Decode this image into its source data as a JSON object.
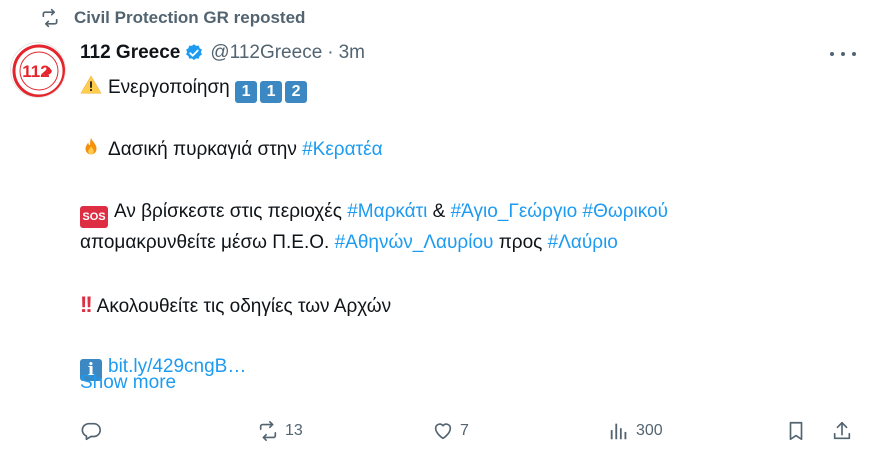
{
  "repost": {
    "text": "Civil Protection GR reposted",
    "icon": "repost-icon"
  },
  "author": {
    "name": "112 Greece",
    "handle": "@112Greece",
    "separator": "·",
    "time": "3m",
    "verified_color": "#1d9bf0",
    "avatar_text": "112"
  },
  "tweet": {
    "line1": {
      "text": "Ενεργοποίηση",
      "keycaps": [
        "1",
        "1",
        "2"
      ]
    },
    "line2": {
      "text": "Δασική πυρκαγιά στην",
      "tag": "#Κερατέα"
    },
    "line3": {
      "sos": "SOS",
      "text": "Αν βρίσκεστε στις περιοχές",
      "tag1": "#Μαρκάτι",
      "amp": "&",
      "tag2": "#Άγιο_Γεώργιο",
      "tag3": "#Θωρικού"
    },
    "line4": {
      "text": "απομακρυνθείτε μέσω Π.Ε.Ο.",
      "tag1": "#Αθηνών_Λαυρίου",
      "mid": "προς",
      "tag2": "#Λαύριο"
    },
    "line5": {
      "text": "Ακολουθείτε τις οδηγίες των Αρχών"
    },
    "line6": {
      "link": "bit.ly/429cngB…"
    },
    "show_more": "Show more"
  },
  "actions": {
    "reply": {
      "icon": "reply-icon"
    },
    "repost": {
      "icon": "repost-icon",
      "count": "13"
    },
    "like": {
      "icon": "heart-icon",
      "count": "7"
    },
    "views": {
      "icon": "views-icon",
      "count": "300"
    },
    "bookmark": {
      "icon": "bookmark-icon"
    },
    "share": {
      "icon": "share-icon"
    }
  },
  "colors": {
    "accent": "#1d9bf0",
    "muted": "#536471",
    "text": "#0f1419"
  }
}
